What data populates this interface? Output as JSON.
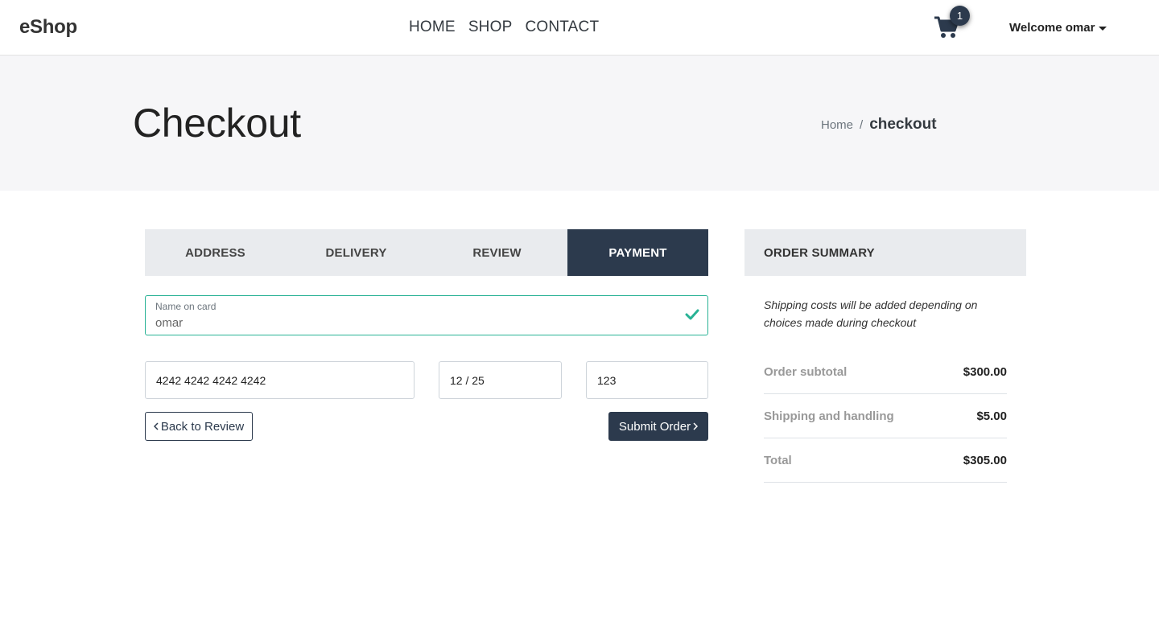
{
  "navbar": {
    "brand": "eShop",
    "links": [
      "HOME",
      "SHOP",
      "CONTACT"
    ],
    "cart_count": "1",
    "welcome": "Welcome omar"
  },
  "hero": {
    "title": "Checkout",
    "breadcrumb_home": "Home",
    "breadcrumb_sep": "/",
    "breadcrumb_current": "checkout"
  },
  "steps": [
    "ADDRESS",
    "DELIVERY",
    "REVIEW",
    "PAYMENT"
  ],
  "payment": {
    "name_label": "Name on card",
    "name_value": "omar",
    "card_number": "4242 4242 4242 4242",
    "expiry": "12 / 25",
    "cvc": "123",
    "back_label": "Back to Review",
    "submit_label": "Submit Order"
  },
  "summary": {
    "title": "ORDER SUMMARY",
    "note": "Shipping costs will be added depending on choices made during checkout",
    "rows": [
      {
        "label": "Order subtotal",
        "value": "$300.00"
      },
      {
        "label": "Shipping and handling",
        "value": "$5.00"
      },
      {
        "label": "Total",
        "value": "$305.00"
      }
    ]
  },
  "colors": {
    "primary_dark": "#2c3a4d",
    "valid_green": "#28b295",
    "panel_gray": "#e9ebee",
    "hero_bg": "#f6f6f8"
  }
}
